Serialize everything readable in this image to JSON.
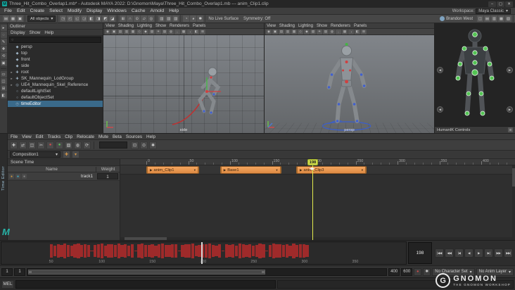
{
  "title_bar": {
    "title": "Three_Hit_Combo_Overlap1.mb* - Autodesk MAYA 2022: D:\\Gnomon\\Maya\\Three_Hit_Combo_Overlap1.mb --- anim_Clip1.clip",
    "badge": "M",
    "window_controls": [
      {
        "name": "minimize-button",
        "glyph": "–"
      },
      {
        "name": "maximize-button",
        "glyph": "▢"
      },
      {
        "name": "close-button",
        "glyph": "✕"
      }
    ]
  },
  "menu_bar": {
    "items": [
      "File",
      "Edit",
      "Create",
      "Select",
      "Modify",
      "Display",
      "Windows",
      "Cache",
      "Arnold",
      "Help"
    ],
    "workspace_label": "Workspace:",
    "workspace_value": "Maya Classic"
  },
  "status_line": {
    "segments": [
      {
        "type": "icons",
        "name": "scene-file-group",
        "icons": [
          {
            "name": "new-scene-icon",
            "glyph": "▤"
          },
          {
            "name": "open-scene-icon",
            "glyph": "▦"
          },
          {
            "name": "save-scene-icon",
            "glyph": "▣"
          }
        ]
      },
      {
        "type": "dropdown",
        "name": "selection-mode-dropdown",
        "value": "All objects"
      },
      {
        "type": "icons",
        "name": "selection-mask-group",
        "icons": [
          {
            "name": "select-hierarchy-icon",
            "glyph": "◳"
          },
          {
            "name": "select-object-icon",
            "glyph": "◰"
          },
          {
            "name": "select-component-icon",
            "glyph": "◱"
          },
          {
            "name": "select-mesh-icon",
            "glyph": "◲"
          },
          {
            "name": "select-curve-icon",
            "glyph": "◧"
          },
          {
            "name": "select-surface-icon",
            "glyph": "◨"
          },
          {
            "name": "select-deformer-icon",
            "glyph": "◩"
          },
          {
            "name": "select-dynamic-icon",
            "glyph": "◪"
          }
        ]
      },
      {
        "type": "icons",
        "name": "snapping-group",
        "icons": [
          {
            "name": "snap-to-grid-icon",
            "glyph": "⊞"
          },
          {
            "name": "snap-to-curve-icon",
            "glyph": "∩"
          },
          {
            "name": "snap-to-point-icon",
            "glyph": "⊙"
          },
          {
            "name": "snap-to-plane-icon",
            "glyph": "▱"
          },
          {
            "name": "make-live-icon",
            "glyph": "◎"
          }
        ]
      },
      {
        "type": "icons",
        "name": "history-group",
        "icons": [
          {
            "name": "construction-history-icon",
            "glyph": "▥"
          },
          {
            "name": "input-connections-icon",
            "glyph": "▨"
          },
          {
            "name": "output-connections-icon",
            "glyph": "▧"
          }
        ]
      },
      {
        "type": "icons",
        "name": "render-group",
        "icons": [
          {
            "name": "render-frame-icon",
            "glyph": "◔"
          },
          {
            "name": "ipr-render-icon",
            "glyph": "◕"
          },
          {
            "name": "render-settings-icon",
            "glyph": "✱"
          }
        ]
      },
      {
        "type": "text",
        "name": "live-surface-status",
        "value": "No Live Surface"
      },
      {
        "type": "text",
        "name": "symmetry-status",
        "value": "Symmetry: Off"
      },
      {
        "type": "spacer"
      },
      {
        "type": "user",
        "name": "signed-in-user",
        "value": "Brandon West"
      },
      {
        "type": "icons",
        "name": "sidebar-toggle-group",
        "icons": [
          {
            "name": "modeling-toolkit-icon",
            "glyph": "◫"
          },
          {
            "name": "hypershade-icon",
            "glyph": "▤"
          },
          {
            "name": "tool-settings-icon",
            "glyph": "▥"
          },
          {
            "name": "attribute-editor-icon",
            "glyph": "▦"
          },
          {
            "name": "channel-box-icon",
            "glyph": "▧"
          }
        ]
      }
    ]
  },
  "tool_box": {
    "tools": [
      {
        "name": "select-tool-icon",
        "glyph": "▸"
      },
      {
        "name": "lasso-tool-icon",
        "glyph": "◌"
      },
      {
        "name": "paint-select-tool-icon",
        "glyph": "✎"
      },
      {
        "name": "move-tool-icon",
        "glyph": "✚"
      },
      {
        "name": "rotate-tool-icon",
        "glyph": "⟲"
      },
      {
        "name": "scale-tool-icon",
        "glyph": "▣"
      }
    ],
    "layouts": [
      {
        "name": "single-pane-layout-button",
        "glyph": "▭"
      },
      {
        "name": "two-pane-layout-button",
        "glyph": "◫"
      },
      {
        "name": "four-pane-layout-button",
        "glyph": "⊞"
      },
      {
        "name": "outliner-persp-layout-button",
        "glyph": "◧"
      }
    ]
  },
  "outliner": {
    "title": "Outliner",
    "menus": [
      "Display",
      "Show",
      "Help"
    ],
    "search_placeholder": "",
    "items": [
      {
        "label": "persp",
        "icon": "camera-icon",
        "glyph": "◆",
        "expandable": false,
        "selected": false
      },
      {
        "label": "top",
        "icon": "camera-icon",
        "glyph": "◆",
        "expandable": false,
        "selected": false
      },
      {
        "label": "front",
        "icon": "camera-icon",
        "glyph": "◆",
        "expandable": false,
        "selected": false
      },
      {
        "label": "side",
        "icon": "camera-icon",
        "glyph": "◆",
        "expandable": false,
        "selected": false
      },
      {
        "label": "root",
        "icon": "joint-icon",
        "glyph": "✚",
        "expandable": true,
        "selected": false
      },
      {
        "label": "SK_Mannequin_LodGroup",
        "icon": "group-icon",
        "glyph": "✚",
        "expandable": true,
        "selected": false
      },
      {
        "label": "UE4_Mannequin_Skel_Reference",
        "icon": "reference-icon",
        "glyph": "◎",
        "expandable": true,
        "selected": false
      },
      {
        "label": "defaultLightSet",
        "icon": "set-icon",
        "glyph": "○",
        "expandable": false,
        "selected": false
      },
      {
        "label": "defaultObjectSet",
        "icon": "set-icon",
        "glyph": "○",
        "expandable": false,
        "selected": false
      },
      {
        "label": "timeEditor",
        "icon": "time-editor-icon",
        "glyph": "◷",
        "expandable": false,
        "selected": true
      }
    ]
  },
  "viewports": [
    {
      "menus": [
        "View",
        "Shading",
        "Lighting",
        "Show",
        "Renderers",
        "Panels"
      ],
      "camera_label": "side"
    },
    {
      "menus": [
        "View",
        "Shading",
        "Lighting",
        "Show",
        "Renderers",
        "Panels"
      ],
      "camera_label": "persp"
    }
  ],
  "viewport_icons": [
    {
      "name": "select-camera-icon",
      "glyph": "◉"
    },
    {
      "name": "lock-camera-icon",
      "glyph": "▣"
    },
    {
      "name": "camera-attributes-icon",
      "glyph": "▤"
    },
    {
      "name": "bookmarks-icon",
      "glyph": "▥"
    },
    {
      "name": "image-plane-icon",
      "glyph": "▦"
    },
    {
      "name": "wireframe-icon",
      "glyph": "◇"
    },
    {
      "name": "shaded-icon",
      "glyph": "◆"
    },
    {
      "name": "textured-icon",
      "glyph": "▧"
    },
    {
      "name": "lights-icon",
      "glyph": "☀"
    },
    {
      "name": "shadows-icon",
      "glyph": "▨"
    },
    {
      "name": "screen-space-ao-icon",
      "glyph": "◍"
    },
    {
      "name": "motion-blur-icon",
      "glyph": "◌"
    },
    {
      "name": "multisample-icon",
      "glyph": "▩"
    },
    {
      "name": "xray-icon",
      "glyph": "◔"
    },
    {
      "name": "isolate-select-icon",
      "glyph": "◧"
    },
    {
      "name": "grid-icon",
      "glyph": "⊞"
    }
  ],
  "humanik": {
    "title": "HumanIK Controls",
    "nav_buttons": [
      {
        "name": "hik-nav-left-button",
        "glyph": "◀",
        "pos": "left"
      },
      {
        "name": "hik-nav-right-button",
        "glyph": "▶",
        "pos": "right"
      },
      {
        "name": "hik-nav-down-left-button",
        "glyph": "◀",
        "pos": "bottom-left"
      },
      {
        "name": "hik-nav-down-right-button",
        "glyph": "▶",
        "pos": "bottom-right"
      }
    ]
  },
  "time_editor": {
    "panel_tab": "Time Editor",
    "menus": [
      "File",
      "View",
      "Edit",
      "Tracks",
      "Clip",
      "Relocate",
      "Mute",
      "Beta",
      "Sources",
      "Help"
    ],
    "toolbar": [
      {
        "name": "move-keys-icon",
        "glyph": "✚"
      },
      {
        "name": "ripple-edit-icon",
        "glyph": "⇄"
      },
      {
        "name": "trim-clip-icon",
        "glyph": "◫"
      },
      {
        "name": "razor-clip-icon",
        "glyph": "✂"
      },
      {
        "name": "set-key-icon",
        "glyph": "●",
        "color": "#d04a4a"
      },
      {
        "name": "set-zero-key-icon",
        "glyph": "●",
        "color": "#58c558"
      },
      {
        "name": "add-clip-icon",
        "glyph": "▧"
      },
      {
        "name": "ghost-clip-icon",
        "glyph": "◍"
      },
      {
        "name": "loop-clip-icon",
        "glyph": "⟳"
      }
    ],
    "toolbar_right": [
      {
        "name": "frame-all-icon",
        "glyph": "⊡"
      },
      {
        "name": "frame-playhead-icon",
        "glyph": "⊙"
      },
      {
        "name": "te-options-icon",
        "glyph": "✱"
      }
    ],
    "composition": "Composition1",
    "composition_buttons": [
      {
        "name": "add-composition-button",
        "glyph": "✚",
        "color": "#d89a4a"
      },
      {
        "name": "composition-options-button",
        "glyph": "▾",
        "color": "#d89a4a"
      }
    ],
    "scene_time_label": "Scene Time",
    "columns": [
      "Name",
      "Weight"
    ],
    "tracks": [
      {
        "name": "track1",
        "weight": "1"
      }
    ],
    "track_buttons": [
      {
        "name": "track-mute-button",
        "glyph": "●",
        "color": "#c9963f"
      },
      {
        "name": "track-solo-button",
        "glyph": "●",
        "color": "#3fb0c9"
      },
      {
        "name": "track-ghost-button",
        "glyph": "●",
        "color": "#8a8a8a"
      }
    ],
    "clips": [
      {
        "label": "anim_Clip1",
        "start": 0,
        "end": 63
      },
      {
        "label": "Base1",
        "start": 88,
        "end": 161
      },
      {
        "label": "anim_Clip3",
        "start": 179,
        "end": 263
      }
    ],
    "playhead_frame": 198,
    "ruler_max_frame": 440,
    "ruler_label_step": 50
  },
  "time_slider": {
    "range_start": 1,
    "range_end": 400,
    "current_frame": 198,
    "tick_labels": [
      50,
      100,
      150,
      200,
      250,
      300,
      350
    ],
    "current_frame_field": "198",
    "waveform": [
      0.9,
      0.75,
      0.95,
      0.8,
      1,
      0.85,
      0.7,
      0.9,
      1,
      0.8,
      0.95,
      0.85,
      0.08,
      0.85,
      0.9,
      1,
      0.75,
      0.9,
      0.95,
      0.8,
      1,
      0.85,
      0.9,
      0.7,
      0.95,
      0.08,
      0.9,
      1,
      0.8,
      0.85,
      0.95,
      0.75,
      0.9,
      1,
      0.85,
      0.8,
      0.95,
      0.9,
      0.08,
      0.8,
      0.95,
      0.9,
      1,
      0.7,
      0.85,
      0.9,
      0.95,
      1,
      0.8,
      0.75,
      0.9,
      0.08,
      0.95,
      0.85,
      0.9,
      0.75,
      1,
      0.9,
      0.8,
      0.95,
      0.7,
      0.85,
      1,
      0.9,
      0.08,
      0.85,
      1,
      0.9,
      0.95,
      0.8,
      0.9,
      0.75,
      1,
      0.85,
      0.95,
      0.9,
      0.8
    ]
  },
  "transport": [
    {
      "name": "go-to-range-start-button",
      "glyph": "|◀◀"
    },
    {
      "name": "step-back-frame-button",
      "glyph": "◀◀"
    },
    {
      "name": "step-back-key-button",
      "glyph": "|◀"
    },
    {
      "name": "play-backwards-button",
      "glyph": "◀"
    },
    {
      "name": "play-forwards-button",
      "glyph": "▶"
    },
    {
      "name": "step-forward-key-button",
      "glyph": "▶|"
    },
    {
      "name": "step-forward-frame-button",
      "glyph": "▶▶"
    },
    {
      "name": "go-to-range-end-button",
      "glyph": "▶▶|"
    }
  ],
  "range_bar": {
    "anim_start": "1",
    "playback_start": "1",
    "playback_end": "400",
    "anim_end": "600",
    "character_set": "No Character Set",
    "anim_layer": "No Anim Layer",
    "icons": [
      {
        "name": "auto-keyframe-button",
        "glyph": "●",
        "color": "#c94a4a"
      },
      {
        "name": "animation-preferences-button",
        "glyph": "✱",
        "color": "#cccccc"
      }
    ]
  },
  "command_line": {
    "label": "MEL",
    "input_value": ""
  },
  "watermark": {
    "logo_letter": "G",
    "text": "GNOMON",
    "subtext": "THE GNOMON WORKSHOP"
  },
  "maya_logo_letter": "M"
}
